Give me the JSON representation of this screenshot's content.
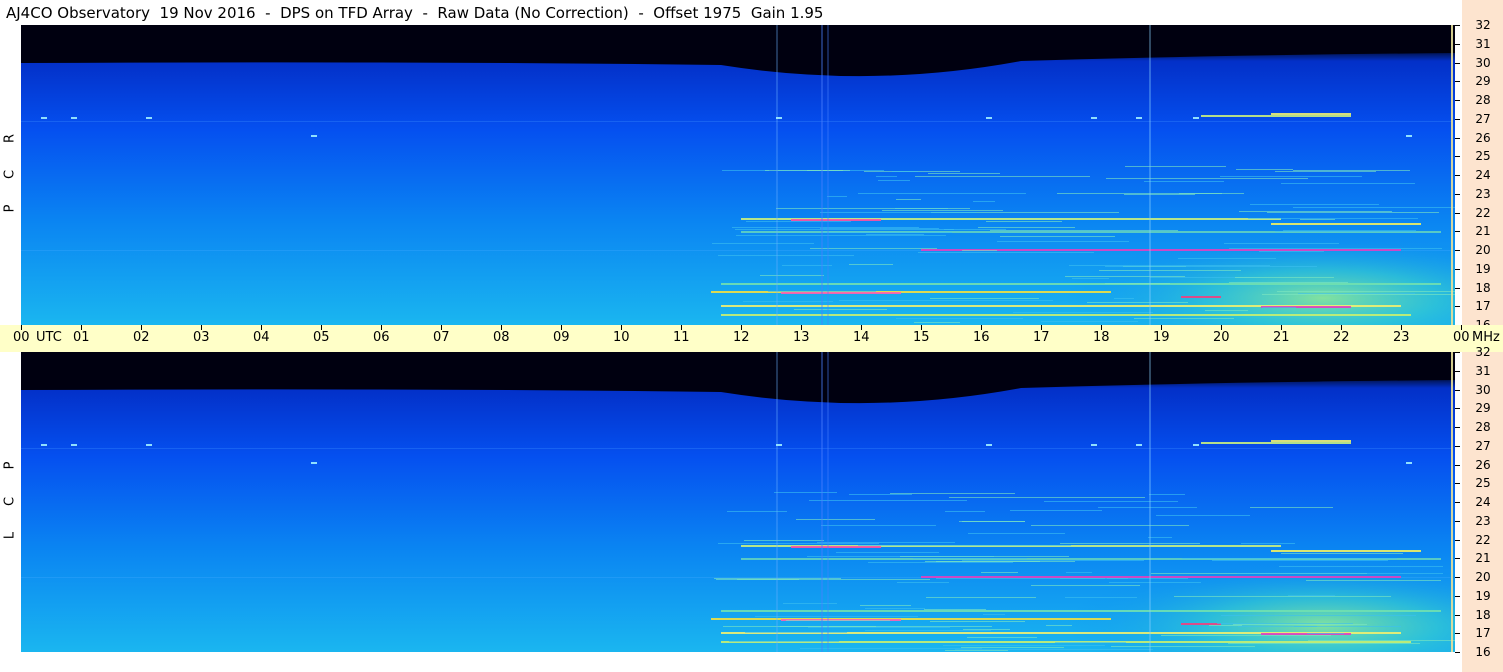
{
  "title": "AJ4CO Observatory  19 Nov 2016  -  DPS on TFD Array  -  Raw Data (No Correction)  -  Offset 1975  Gain 1.95",
  "panels": [
    {
      "name": "RCP",
      "letters": [
        "R",
        "C",
        "P"
      ]
    },
    {
      "name": "LCP",
      "letters": [
        "L",
        "C",
        "P"
      ]
    }
  ],
  "time_axis": {
    "unit_label": "UTC",
    "freq_unit": "MHz",
    "labels": [
      "00",
      "01",
      "02",
      "03",
      "04",
      "05",
      "06",
      "07",
      "08",
      "09",
      "10",
      "11",
      "12",
      "13",
      "14",
      "15",
      "16",
      "17",
      "18",
      "19",
      "20",
      "21",
      "22",
      "23",
      "00"
    ]
  },
  "freq_axis": {
    "labels": [
      "32",
      "31",
      "30",
      "29",
      "28",
      "27",
      "26",
      "25",
      "24",
      "23",
      "22",
      "21",
      "20",
      "19",
      "18",
      "17",
      "16"
    ]
  },
  "colors": {
    "background_dark": "#000010",
    "low_blue": "#0040e0",
    "mid_blue": "#0a82f0",
    "cyan": "#22c4e8",
    "green_yellow": "#b0f070",
    "yellow": "#f0e040",
    "magenta": "#e040c0",
    "axis_strip": "#fde4cf",
    "utc_bar": "#ffffc8"
  }
}
